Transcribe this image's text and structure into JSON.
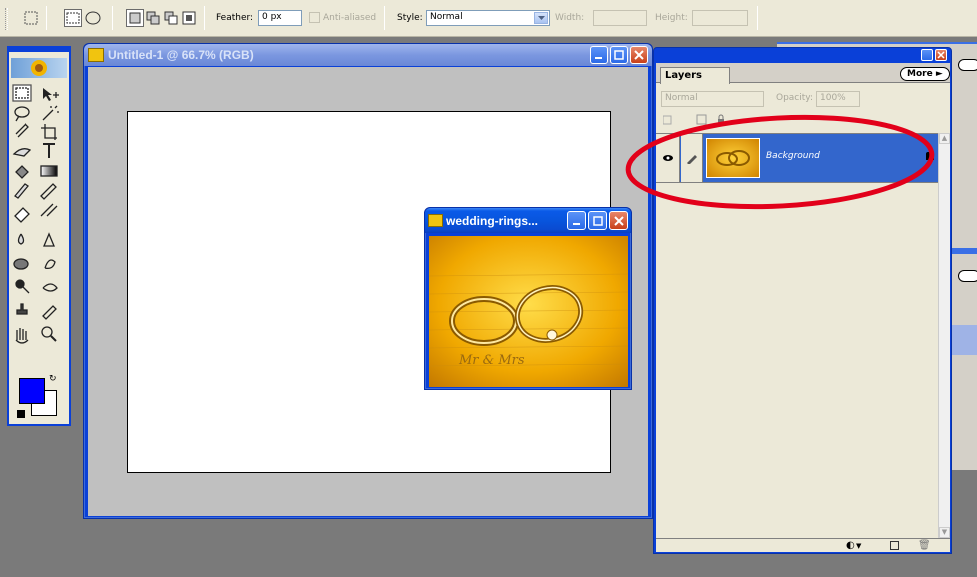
{
  "options": {
    "feather_label": "Feather:",
    "feather_value": "0 px",
    "antialias_label": "Anti-aliased",
    "style_label": "Style:",
    "style_value": "Normal",
    "width_label": "Width:",
    "height_label": "Height:"
  },
  "doc_window": {
    "title": "Untitled-1 @ 66.7% (RGB)"
  },
  "image_window": {
    "title": "wedding-rings...",
    "engraving": "Mr  &  Mrs"
  },
  "layers": {
    "tab": "Layers",
    "more": "More",
    "blend": "Normal",
    "opacity_label": "Opacity:",
    "opacity_value": "100%",
    "layer_name": "Background"
  },
  "colors": {
    "foreground": "#0000ff",
    "background": "#ffffff",
    "annotation": "#e2001a",
    "selection": "#3366cc"
  }
}
